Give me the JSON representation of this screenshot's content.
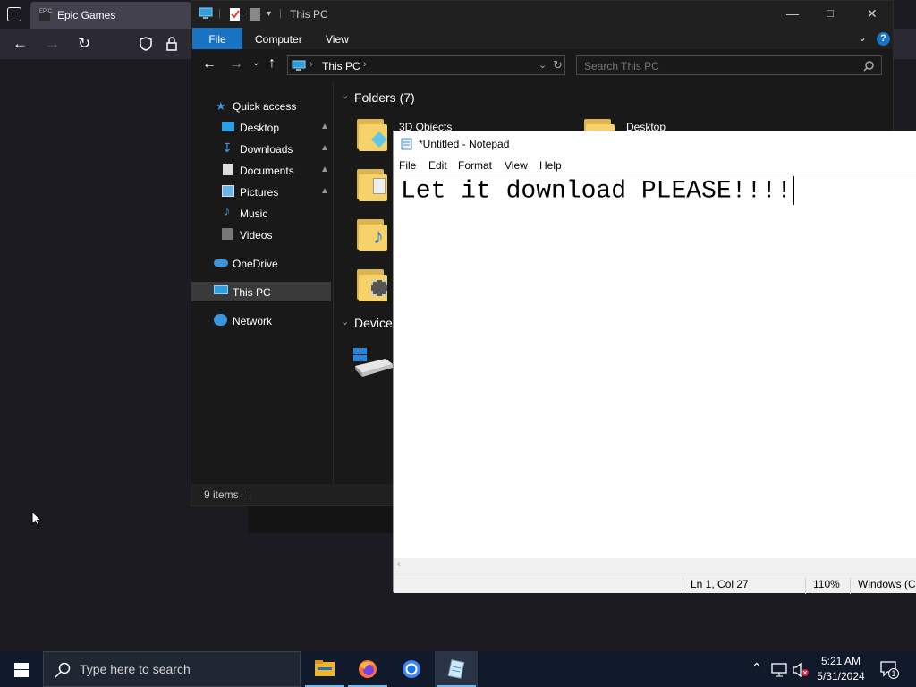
{
  "browser": {
    "tab_title": "Epic Games",
    "favicon_text": "EPIC"
  },
  "explorer": {
    "title": "This PC",
    "ribbon_tabs": [
      "File",
      "Computer",
      "View"
    ],
    "breadcrumb": "This PC",
    "search_placeholder": "Search This PC",
    "nav": {
      "quick_access": "Quick access",
      "desktop": "Desktop",
      "downloads": "Downloads",
      "documents": "Documents",
      "pictures": "Pictures",
      "music": "Music",
      "videos": "Videos",
      "onedrive": "OneDrive",
      "this_pc": "This PC",
      "network": "Network"
    },
    "folders_header": "Folders (7)",
    "folder_1": "3D Objects",
    "folder_2": "Desktop",
    "devices_header": "Device",
    "status": "9 items"
  },
  "notepad": {
    "title": "*Untitled - Notepad",
    "menus": [
      "File",
      "Edit",
      "Format",
      "View",
      "Help"
    ],
    "content": "Let it download PLEASE!!!!",
    "status_position": "Ln 1, Col 27",
    "status_zoom": "110%",
    "status_eol": "Windows (CRLF)"
  },
  "taskbar": {
    "search_placeholder": "Type here to search",
    "time": "5:21 AM",
    "date": "5/31/2024",
    "notification_count": "1"
  },
  "colors": {
    "explorer_bg": "#191919",
    "ribbon_file_accent": "#1a73c2",
    "taskbar_bg": "#101a2a",
    "active_app_underline": "#76b9ed"
  }
}
